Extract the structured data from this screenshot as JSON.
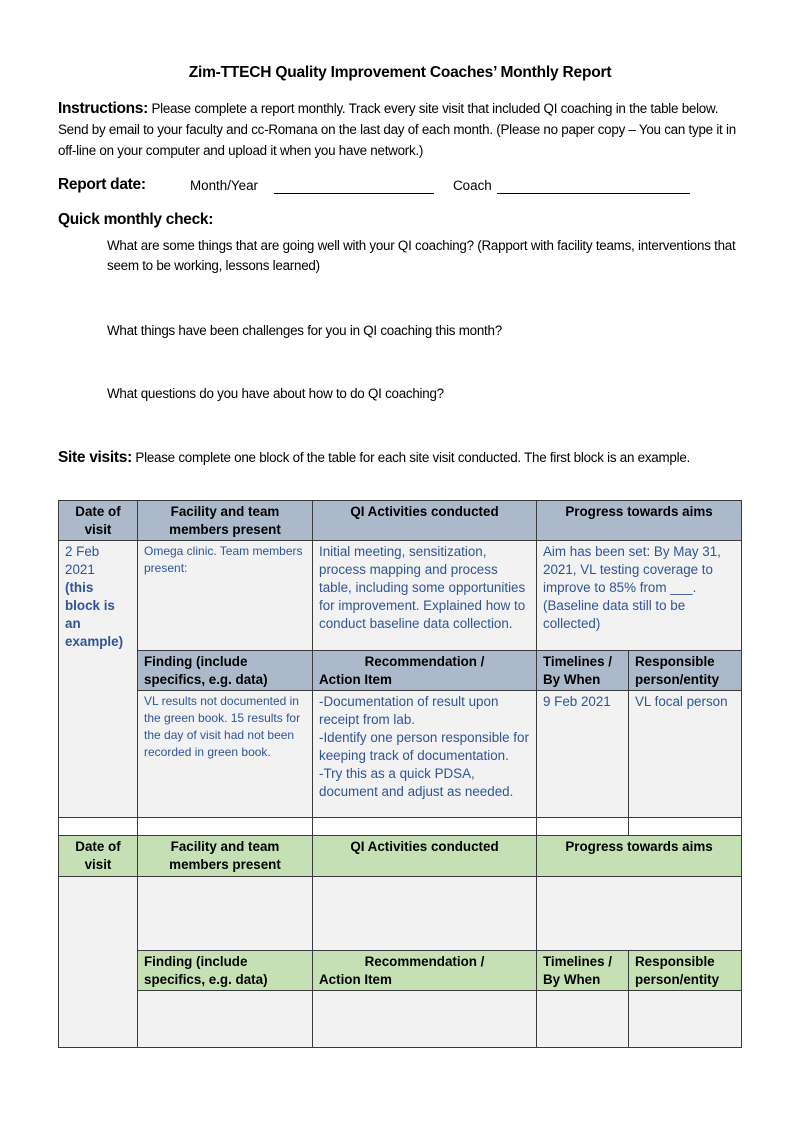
{
  "title": "Zim-TTECH Quality Improvement Coaches’ Monthly Report",
  "instructions": {
    "label": "Instructions:",
    "text": " Please complete a report monthly.  Track every site visit that included QI coaching in the table below.  Send by email to your faculty and cc-Romana on the last day of each month.  (Please no paper copy – You can type it in off-line on your computer and upload it when you have network.)"
  },
  "report_date": {
    "label": "Report date:",
    "month_year_label": "Month/Year",
    "month_year_value": "",
    "coach_label": "Coach",
    "coach_value": ""
  },
  "quick_check": {
    "label": "Quick monthly check:",
    "questions": [
      "What are some things that are going well with your QI coaching? (Rapport with facility teams, interventions that seem to be working, lessons learned)",
      "What things have been challenges for you in QI coaching this month?",
      "What questions do you have about how to do QI coaching?"
    ]
  },
  "site_visits": {
    "label": "Site visits:",
    "text": " Please complete one block of the table for each site visit conducted. The first block is an example."
  },
  "table": {
    "headers": {
      "date": "Date of visit",
      "facility": "Facility and team members present",
      "activities": "QI Activities conducted",
      "progress": "Progress towards aims"
    },
    "sub_headers": {
      "finding": "Finding (include specifics, e.g. data)",
      "recommendation_line1": "Recommendation /",
      "recommendation_line2": "Action Item",
      "timelines": "Timelines / By When",
      "responsible": "Responsible person/entity"
    },
    "example": {
      "date": "2 Feb 2021",
      "date_note": "(this block is an example)",
      "facility": "Omega clinic.  Team members present:",
      "activities": "Initial meeting, sensitization, process mapping and process table, including some opportunities for improvement. Explained how to conduct baseline data collection.",
      "progress": "Aim has been set: By May 31, 2021, VL testing coverage to improve to 85% from ___. (Baseline data still to be collected)",
      "finding": "VL results not documented in the green book.  15 results for the day of visit had not been recorded in green book.",
      "recommendation": [
        "-Documentation of result upon receipt from lab.",
        "-Identify one person responsible for keeping track of documentation.",
        "-Try this as a quick PDSA, document  and adjust as needed."
      ],
      "timeline": "9 Feb 2021",
      "responsible": "VL focal person"
    },
    "blank_block": {
      "date": "",
      "facility": "",
      "activities": "",
      "progress": "",
      "finding": "",
      "recommendation": "",
      "timeline": "",
      "responsible": ""
    }
  },
  "colors": {
    "example_header": "#acb9ca",
    "blank_header": "#c5e0b4",
    "body_fill": "#f2f2f2",
    "example_text": "#2f5597"
  }
}
